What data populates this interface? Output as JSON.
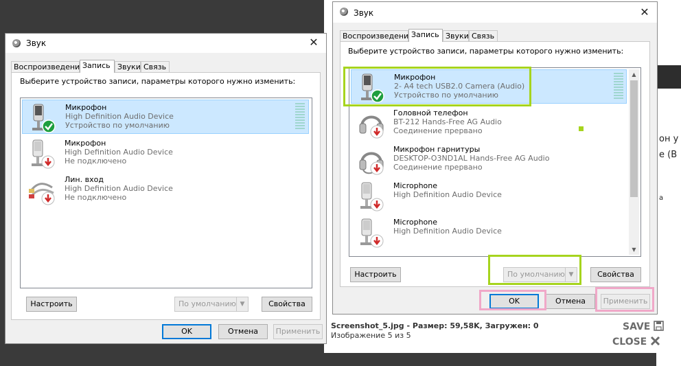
{
  "background_right": {
    "line1": "он у",
    "line2": "е (В",
    "line3": "а"
  },
  "dialog_left": {
    "title": "Звук",
    "tabs": [
      "Воспроизведение",
      "Запись",
      "Звуки",
      "Связь"
    ],
    "active_tab": "Запись",
    "prompt": "Выберите устройство записи, параметры которого нужно изменить:",
    "devices": [
      {
        "name": "Микрофон",
        "driver": "High Definition Audio Device",
        "status": "Устройство по умолчанию",
        "icon": "microphone-icon",
        "badge": "check-badge-icon",
        "selected": true
      },
      {
        "name": "Микрофон",
        "driver": "High Definition Audio Device",
        "status": "Не подключено",
        "icon": "microphone-icon",
        "badge": "down-arrow-badge-icon",
        "selected": false
      },
      {
        "name": "Лин. вход",
        "driver": "High Definition Audio Device",
        "status": "Не подключено",
        "icon": "line-in-cable-icon",
        "badge": "down-arrow-badge-icon",
        "selected": false
      }
    ],
    "configure": "Настроить",
    "set_default": "По умолчанию",
    "properties": "Свойства",
    "ok": "OK",
    "cancel": "Отмена",
    "apply": "Применить"
  },
  "dialog_right": {
    "title": "Звук",
    "tabs": [
      "Воспроизведение",
      "Запись",
      "Звуки",
      "Связь"
    ],
    "active_tab": "Запись",
    "prompt": "Выберите устройство записи, параметры которого нужно изменить:",
    "devices": [
      {
        "name": "Микрофон",
        "driver": "2- A4 tech USB2.0 Camera (Audio)",
        "status": "Устройство по умолчанию",
        "icon": "microphone-icon",
        "badge": "check-badge-icon",
        "selected": true
      },
      {
        "name": "Головной телефон",
        "driver": "BT-212 Hands-Free AG Audio",
        "status": "Соединение прервано",
        "icon": "headset-icon",
        "badge": "down-arrow-badge-icon",
        "selected": false
      },
      {
        "name": "Микрофон гарнитуры",
        "driver": "DESKTOP-O3ND1AL Hands-Free AG Audio",
        "status": "Соединение прервано",
        "icon": "headset-icon",
        "badge": "down-arrow-badge-icon",
        "selected": false
      },
      {
        "name": "Microphone",
        "driver": "High Definition Audio Device",
        "status": "",
        "icon": "microphone-icon",
        "badge": "down-arrow-badge-icon",
        "selected": false
      },
      {
        "name": "Microphone",
        "driver": "High Definition Audio Device",
        "status": "",
        "icon": "microphone-icon",
        "badge": "down-arrow-badge-icon",
        "selected": false
      }
    ],
    "configure": "Настроить",
    "set_default": "По умолчанию",
    "properties": "Свойства",
    "ok": "OK",
    "cancel": "Отмена",
    "apply": "Применить"
  },
  "viewer": {
    "file_info": "Screenshot_5.jpg - Размер: 59,58K, Загружен: 0",
    "image_counter": "Изображение 5 из 5",
    "save_label": "SAVE",
    "close_label": "CLOSE"
  },
  "colors": {
    "highlight_green": "#a6d41e",
    "highlight_pink": "#f0a8c8",
    "selection": "#cce8ff",
    "default_button_border": "#0078d7",
    "check_badge": "#1e9e3e",
    "down_badge": "#d02a2a"
  }
}
